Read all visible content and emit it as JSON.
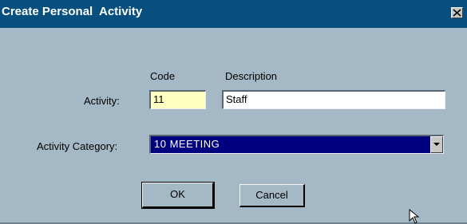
{
  "window": {
    "title": "Create Personal  Activity",
    "close_icon": "close-icon"
  },
  "form": {
    "code_header": "Code",
    "description_header": "Description",
    "activity_label": "Activity:",
    "code_value": "11",
    "description_value": "Staff",
    "category_label": "Activity Category:",
    "category_selected": "10 MEETING",
    "dropdown_icon": "chevron-down-icon"
  },
  "buttons": {
    "ok_label": "OK",
    "cancel_label": "Cancel"
  },
  "colors": {
    "titlebar": "#064f7f",
    "dialog_background": "#a5b8c6",
    "code_field_background": "#ffffc2",
    "selection_highlight": "#000080"
  }
}
